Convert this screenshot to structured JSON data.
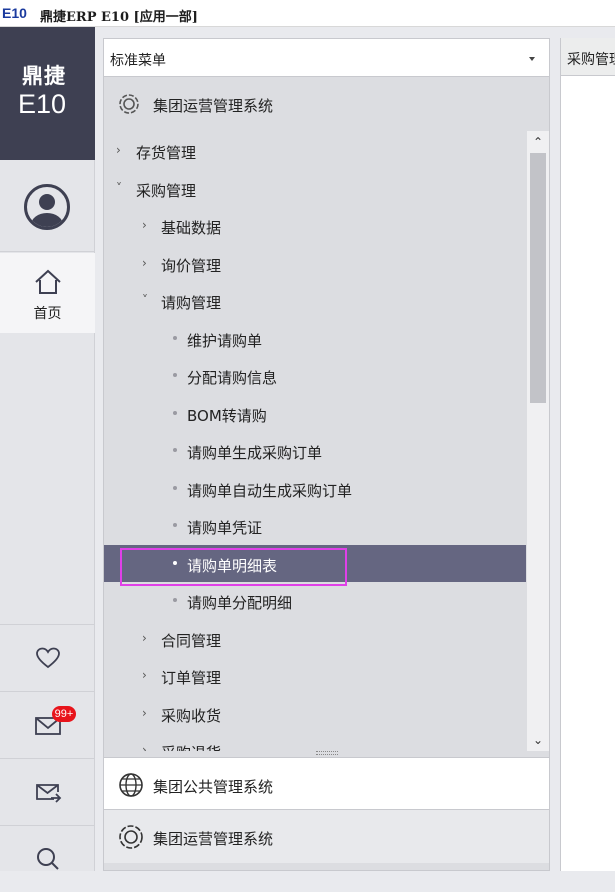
{
  "window": {
    "app_mark": "E10",
    "title": "鼎捷ERP E10 [应用一部]"
  },
  "rail": {
    "brand_cn": "鼎捷",
    "brand_en": "E10",
    "home_label": "首页",
    "mail_badge": "99+"
  },
  "menu": {
    "dropdown_label": "标准菜单",
    "group_top": "集团运营管理系统",
    "group_public": "集团公共管理系统",
    "group_bottom": "集团运营管理系统",
    "tree": [
      {
        "label": "存货管理",
        "level": 1,
        "kind": "collapsed"
      },
      {
        "label": "采购管理",
        "level": 1,
        "kind": "expanded"
      },
      {
        "label": "基础数据",
        "level": 2,
        "kind": "collapsed"
      },
      {
        "label": "询价管理",
        "level": 2,
        "kind": "collapsed"
      },
      {
        "label": "请购管理",
        "level": 2,
        "kind": "expanded"
      },
      {
        "label": "维护请购单",
        "level": 3,
        "kind": "leaf"
      },
      {
        "label": "分配请购信息",
        "level": 3,
        "kind": "leaf"
      },
      {
        "label": "BOM转请购",
        "level": 3,
        "kind": "leaf"
      },
      {
        "label": "请购单生成采购订单",
        "level": 3,
        "kind": "leaf"
      },
      {
        "label": "请购单自动生成采购订单",
        "level": 3,
        "kind": "leaf"
      },
      {
        "label": "请购单凭证",
        "level": 3,
        "kind": "leaf"
      },
      {
        "label": "请购单明细表",
        "level": 3,
        "kind": "leaf",
        "selected": true
      },
      {
        "label": "请购单分配明细",
        "level": 3,
        "kind": "leaf"
      },
      {
        "label": "合同管理",
        "level": 2,
        "kind": "collapsed"
      },
      {
        "label": "订单管理",
        "level": 2,
        "kind": "collapsed"
      },
      {
        "label": "采购收货",
        "level": 2,
        "kind": "collapsed"
      },
      {
        "label": "采购退货",
        "level": 2,
        "kind": "collapsed"
      }
    ]
  },
  "content": {
    "tab_label": "采购管理"
  },
  "colors": {
    "brand_bg": "#3e4052",
    "selected_row": "#656681",
    "highlight_outline": "#e040e8",
    "badge": "#e8141b"
  }
}
